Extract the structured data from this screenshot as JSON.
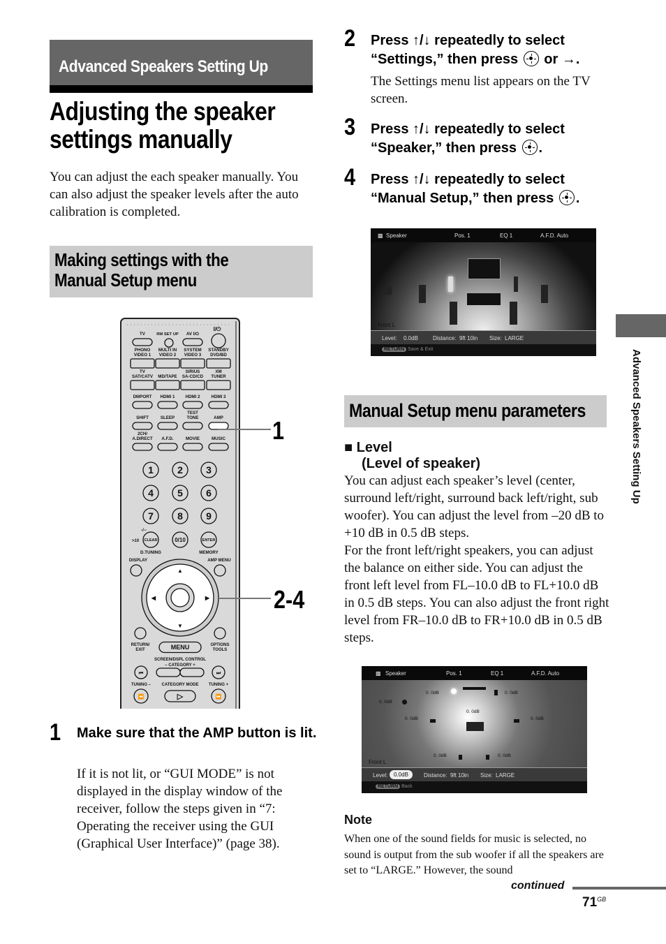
{
  "section_band": "Advanced Speakers Setting Up",
  "page_title_line1": "Adjusting the speaker",
  "page_title_line2": "settings manually",
  "intro": "You can adjust the each speaker manually. You can also adjust the speaker levels after the auto calibration is completed.",
  "subhead_making": "Making settings with the Manual Setup menu",
  "subhead_making_l1": "Making settings with the",
  "subhead_making_l2": "Manual Setup menu",
  "remote": {
    "row1": [
      "TV",
      "RM SET UP",
      "AV I/⏻",
      "I/⏻"
    ],
    "row2_labels": [
      "PHONO\nVIDEO 1",
      "MULTI IN\nVIDEO 2",
      "SYSTEM STANDBY\nVIDEO 3",
      "DVD/BD"
    ],
    "row2_top": [
      "PHONO",
      "MULTI IN",
      "SYSTEM",
      "STANDBY"
    ],
    "row2_bot": [
      "VIDEO 1",
      "VIDEO 2",
      "VIDEO 3",
      "DVD/BD"
    ],
    "row3_top": [
      "TV",
      "",
      "SIRIUS",
      "XM"
    ],
    "row3_bot": [
      "SAT/CATV",
      "MD/TAPE",
      "SA-CD/CD",
      "TUNER"
    ],
    "row4": [
      "DMPORT",
      "HDMI 1",
      "HDMI 2",
      "HDMI 3"
    ],
    "row5_top": [
      "",
      "",
      "TEST",
      ""
    ],
    "row5_bot": [
      "SHIFT",
      "SLEEP",
      "TONE",
      "AMP"
    ],
    "row6_top": [
      "2CH/",
      "",
      "",
      ""
    ],
    "row6_bot": [
      "A.DIRECT",
      "A.F.D.",
      "MOVIE",
      "MUSIC"
    ],
    "digits": [
      "1",
      "2",
      "3",
      "4",
      "5",
      "6",
      "7",
      "8",
      "9"
    ],
    "clear": "CLEAR",
    "zero": "0/10",
    "enter": "ENTER",
    "gt10": ">10",
    "dash": "-/--",
    "dtuning": "D.TUNING",
    "memory": "MEMORY",
    "display": "DISPLAY",
    "amp_menu": "AMP MENU",
    "return_exit": "RETURN/\nEXIT",
    "return_l1": "RETURN/",
    "return_l2": "EXIT",
    "menu": "MENU",
    "options_l1": "OPTIONS",
    "options_l2": "TOOLS",
    "screen_dspl": "SCREEN/DSPL CONTROL",
    "category": "–  CATEGORY  +",
    "tuning_minus": "TUNING –",
    "category_mode": "CATEGORY MODE",
    "tuning_plus": "TUNING +"
  },
  "callouts": {
    "amp": "1",
    "joystick": "2-4"
  },
  "step1": {
    "num": "1",
    "head": "Make sure that the AMP button is lit.",
    "body": "If it is not lit, or “GUI MODE” is not displayed in the display window of the receiver, follow the steps given in “7: Operating the receiver using the GUI (Graphical User Interface)” (page 38)."
  },
  "step2": {
    "num": "2",
    "head_a": "Press ↑/↓ repeatedly to select “Settings,” then press",
    "head_b": "or →.",
    "body": "The Settings menu list appears on the TV screen."
  },
  "step3": {
    "num": "3",
    "head_a": "Press ↑/↓ repeatedly to select “Speaker,” then press",
    "head_b": "."
  },
  "step4": {
    "num": "4",
    "head_a": "Press ↑/↓ repeatedly to select “Manual Setup,” then press",
    "head_b": "."
  },
  "screen1": {
    "title": "Speaker",
    "pos": "Pos. 1",
    "eq": "EQ 1",
    "afd": "A.F.D. Auto",
    "speaker": "Front L",
    "level_label": "Level:",
    "level_value": "0.0dB",
    "distance_label": "Distance:",
    "distance_value": "9ft 10in",
    "size_label": "Size:",
    "size_value": "LARGE",
    "return_btn": "RETURN",
    "return_action": "Save & Exit"
  },
  "screen2": {
    "title": "Speaker",
    "pos": "Pos. 1",
    "eq": "EQ 1",
    "afd": "A.F.D. Auto",
    "speaker": "Front L",
    "speaker_levels": [
      "0. 0dB",
      "0. 0dB",
      "0. 0dB",
      "0. 0dB",
      "0. 0dB",
      "0. 0dB",
      "0. 0dB",
      "0. 0dB"
    ],
    "level_label": "Level:",
    "level_value": "0.0dB",
    "distance_label": "Distance:",
    "distance_value": "9ft 10in",
    "size_label": "Size:",
    "size_value": "LARGE",
    "return_btn": "RETURN",
    "return_action": "Back"
  },
  "side_tab_label": "Advanced Speakers Setting Up",
  "subhead_params": "Manual Setup menu parameters",
  "param_level": {
    "bullet": "■",
    "title": "Level",
    "subtitle": "(Level of speaker)",
    "body1": "You can adjust each speaker’s level (center, surround left/right, surround back left/right, sub woofer). You can adjust the level from –20 dB to +10 dB in 0.5 dB steps.",
    "body2": "For the front left/right speakers, you can adjust the balance on either side. You can adjust the front left level from FL–10.0 dB to FL+10.0 dB in 0.5 dB steps. You can also adjust the front right level from FR–10.0 dB to FR+10.0 dB in 0.5 dB steps."
  },
  "note": {
    "head": "Note",
    "body": "When one of the sound fields for music is selected, no sound is output from the sub woofer if all the speakers are set to “LARGE.” However, the sound"
  },
  "continued": "continued",
  "page_number": "71",
  "page_suffix": "GB"
}
